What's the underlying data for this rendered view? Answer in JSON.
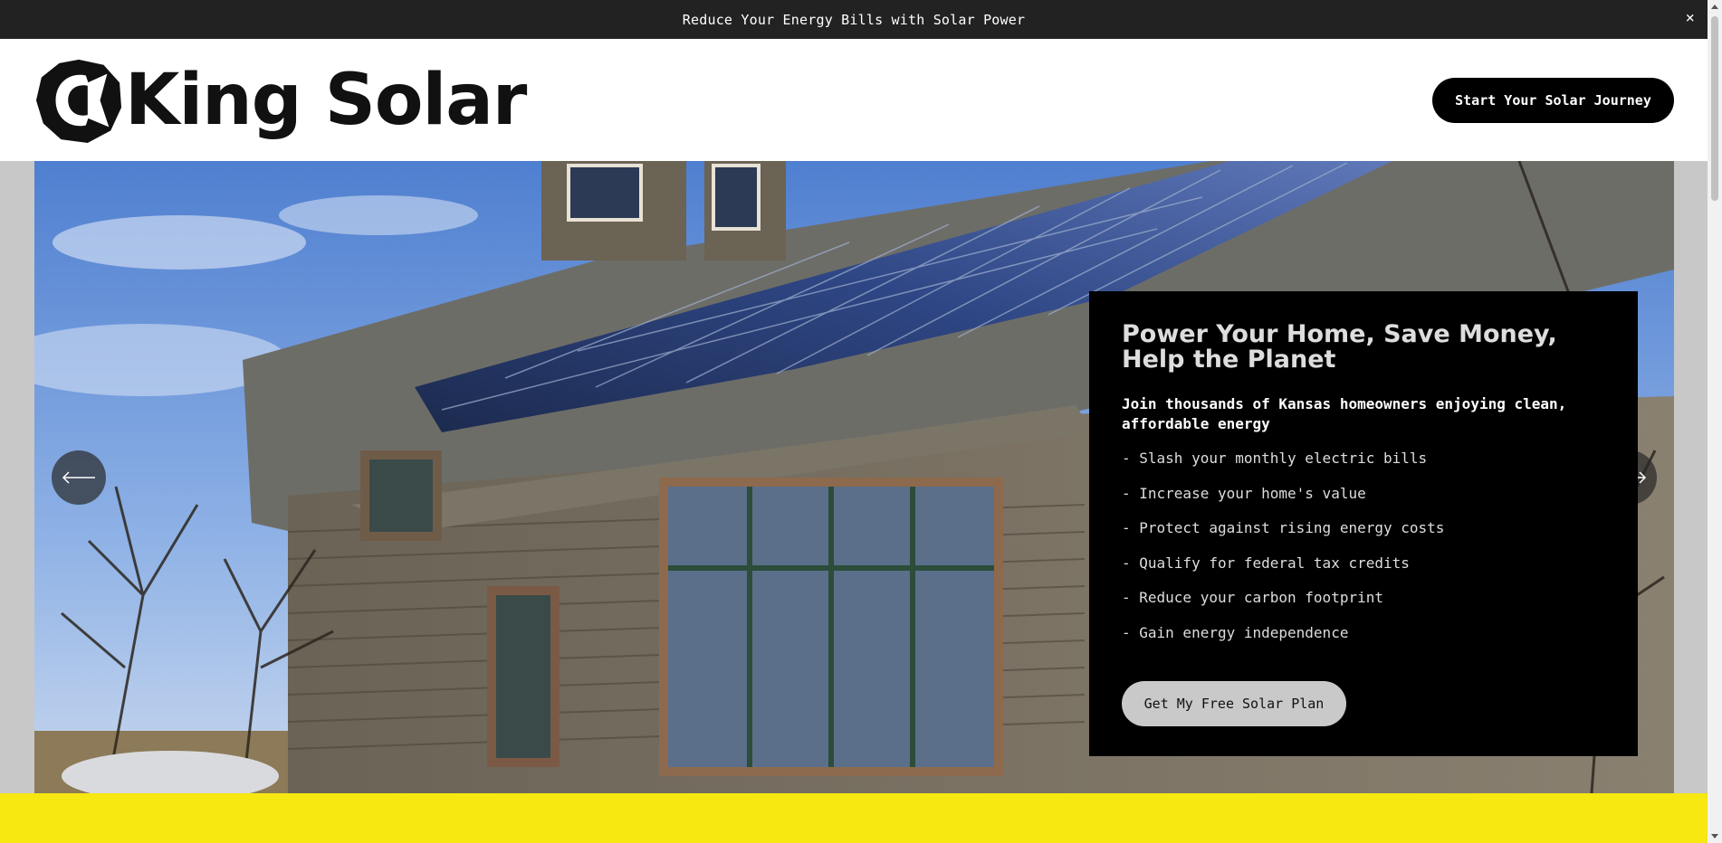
{
  "announcement": {
    "text": "Reduce Your Energy Bills with Solar Power",
    "close_label": "×"
  },
  "header": {
    "logo_text": "King Solar",
    "cta_label": "Start Your Solar Journey"
  },
  "hero": {
    "image_subject": "house with rooftop solar panels",
    "prev_icon": "arrow-left-icon",
    "next_icon": "arrow-right-icon",
    "panel": {
      "title": "Power Your Home, Save Money, Help the Planet",
      "subtitle": "Join thousands of Kansas homeowners enjoying clean, affordable energy",
      "benefits": [
        "- Slash your monthly electric bills",
        "- Increase your home's value",
        "- Protect against rising energy costs",
        "- Qualify for federal tax credits",
        "- Reduce your carbon footprint",
        "- Gain energy independence"
      ],
      "cta_label": "Get My Free Solar Plan"
    }
  },
  "colors": {
    "announcement_bg": "#222222",
    "accent_yellow": "#f6e810",
    "panel_bg": "#000000",
    "header_cta_bg": "#000000",
    "panel_cta_bg": "#c9c9c9"
  }
}
